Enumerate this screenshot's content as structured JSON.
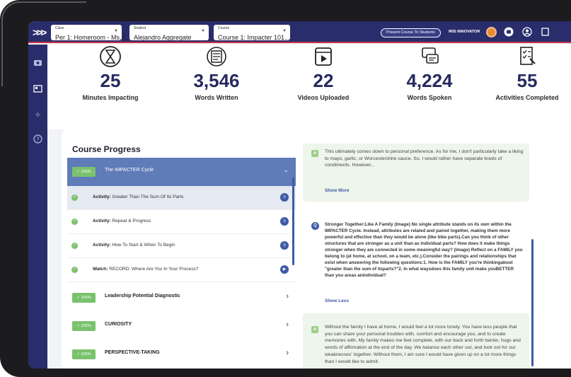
{
  "topbar": {
    "class_label": "Class",
    "class_value": "Per 1: Homeroom - Ms. I...",
    "student_label": "Student",
    "student_value": "Alejandro Aggregate",
    "course_label": "Course",
    "course_value": "Course 1: Impacter 101...",
    "present_button": "Present Course To Students",
    "user_name": "IRIS INNOVATOR"
  },
  "stats": [
    {
      "value": "25",
      "caption": "Minutes Impacting",
      "icon": "hourglass-icon"
    },
    {
      "value": "3,546",
      "caption": "Words Written",
      "icon": "document-icon"
    },
    {
      "value": "22",
      "caption": "Videos Uploaded",
      "icon": "video-icon"
    },
    {
      "value": "4,224",
      "caption": "Words Spoken",
      "icon": "speech-bubble-icon"
    },
    {
      "value": "55",
      "caption": "Activities Completed",
      "icon": "checklist-icon"
    }
  ],
  "course_progress": {
    "title": "Course Progress",
    "active_section": {
      "badge": "✓ 100%",
      "name": "The IMPACTER Cycle"
    },
    "activities": [
      {
        "prefix": "Activity:",
        "text": "Greater Than The Sum Of Its Parts",
        "icon": "document-icon"
      },
      {
        "prefix": "Activity:",
        "text": "Repeat & Progress",
        "icon": "document-icon"
      },
      {
        "prefix": "Activity:",
        "text": "How To Start & When To Begin",
        "icon": "document-icon"
      },
      {
        "prefix": "Watch:",
        "text": "RECORD: Where Are You In Your Process?",
        "icon": "play-icon"
      }
    ],
    "sections": [
      {
        "badge": "✓ 100%",
        "name": "Leadership Potential Diagnostic"
      },
      {
        "badge": "✓ 100%",
        "name": "CURIOSITY"
      },
      {
        "badge": "✓ 100%",
        "name": "PERSPECTIVE-TAKING"
      }
    ]
  },
  "responses": {
    "answer1_badge": "A",
    "answer1": "This ultimately comes down to personal preference. As for me, I don't particularly take a liking to mayo, garlic, or Worcestershire sauce. So, I would rather have separate bowls of condiments. However...",
    "show_more": "Show More",
    "question_badge": "Q",
    "question": "Stronger Together:Like A Family (Image) No single attribute stands on its own within the IMPACTER Cycle. Instead, attributes are related and paired together, making them more powerful and effective than they would be alone (like bike parts).Can you think of other structures that are stronger as a unit than as individual parts? How does it make things stronger when they are connected in some meaningful way? (Image) Reflect on a FAMILY you belong to (at home, at school, on a team, etc.).Consider the pairings and relationships that exist when answering the following questions:1. How is the FAMILY you're thinkingabout \"greater than the sum of itsparts?\"2. In what waysdoes this family unit make youBETTER than you areas anindividual?",
    "show_less": "Show Less",
    "answer2_badge": "A",
    "answer2": "Without the family I have at home, I would feel a lot more lonely. You have less people that you can share your personal troubles with, comfort and encourage you, and to create memories with. My family makes me feel complete, with our back and forth banter, hugs and words of affirmation at the end of the day. We balance each other out, and look out for our weaknesses' together. Without them, I am sure I would have given up on a lot more things than I would like to admit."
  },
  "colors": {
    "nav": "#2a2d6b",
    "accent_red": "#c9334a",
    "active_row": "#5f7bb8",
    "complete_green": "#7ac26d",
    "primary_blue": "#3f5aa6"
  }
}
